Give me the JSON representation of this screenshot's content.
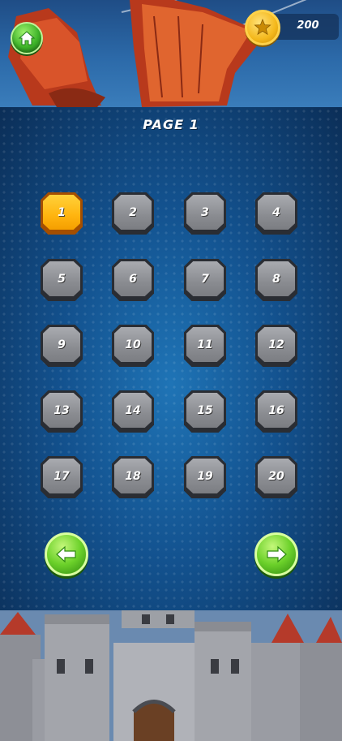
{
  "header": {
    "coins": "200",
    "icons": {
      "home": "home-icon",
      "coin": "star-coin-icon"
    }
  },
  "page": {
    "title": "PAGE 1",
    "current_level": "1"
  },
  "levels": [
    "1",
    "2",
    "3",
    "4",
    "5",
    "6",
    "7",
    "8",
    "9",
    "10",
    "11",
    "12",
    "13",
    "14",
    "15",
    "16",
    "17",
    "18",
    "19",
    "20"
  ],
  "nav": {
    "prev_icon": "arrow-left-icon",
    "next_icon": "arrow-right-icon"
  },
  "colors": {
    "active_level": "#ffb40f",
    "locked_level": "#8a8c91",
    "button_green": "#6cd12a",
    "coin_gold": "#f4b81c",
    "panel_blue": "#13528f"
  }
}
